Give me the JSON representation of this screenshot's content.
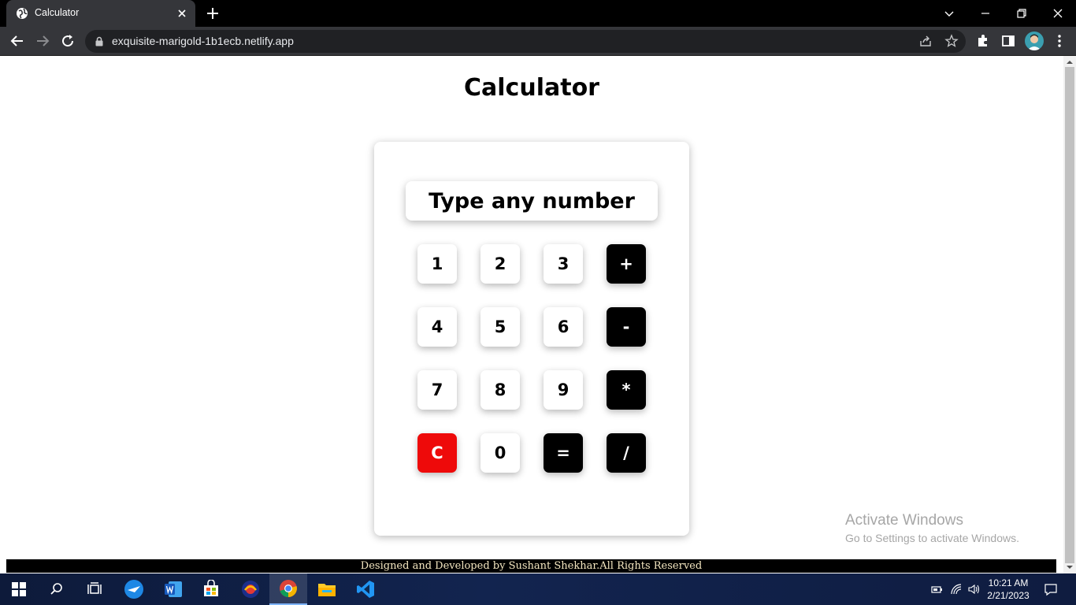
{
  "browser": {
    "tab_title": "Calculator",
    "url": "exquisite-marigold-1b1ecb.netlify.app"
  },
  "page": {
    "title": "Calculator",
    "display_placeholder": "Type any number",
    "keys": {
      "k1": "1",
      "k2": "2",
      "k3": "3",
      "add": "+",
      "k4": "4",
      "k5": "5",
      "k6": "6",
      "subtract": "-",
      "k7": "7",
      "k8": "8",
      "k9": "9",
      "multiply": "*",
      "clear": "C",
      "k0": "0",
      "equals": "=",
      "divide": "/"
    },
    "footer": "Designed and Developed by Sushant Shekhar.All Rights Reserved"
  },
  "watermark": {
    "title": "Activate Windows",
    "subtitle": "Go to Settings to activate Windows."
  },
  "taskbar": {
    "time": "10:21 AM",
    "date": "2/21/2023"
  },
  "colors": {
    "operator_key": "#000000",
    "clear_key": "#ee0a0a",
    "number_key": "#ffffff"
  }
}
